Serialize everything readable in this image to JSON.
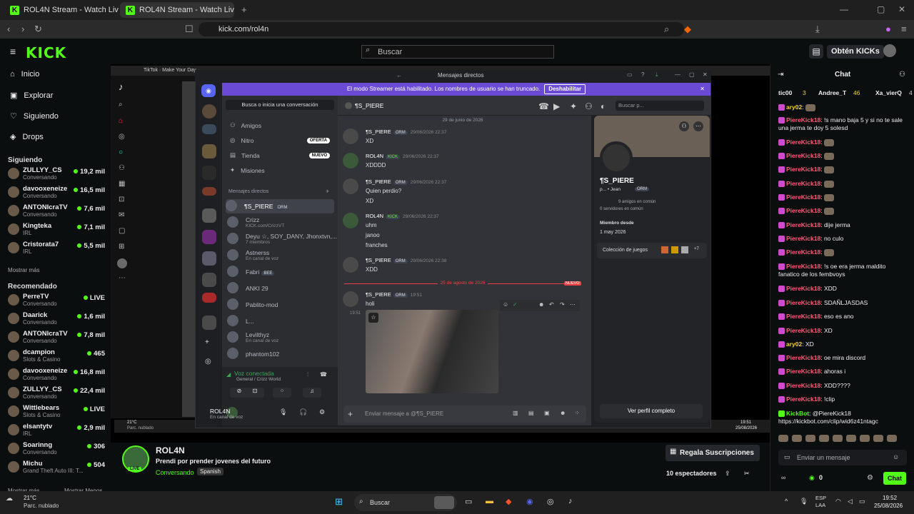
{
  "browser": {
    "tabs": [
      {
        "title": "ROL4N Stream - Watch Live on K"
      },
      {
        "title": "ROL4N Stream - Watch Live o"
      }
    ],
    "url": "kick.com/rol4n"
  },
  "kick": {
    "search_placeholder": "Buscar",
    "obten_label": "Obtén KICKs",
    "logo": "KICK",
    "nav": [
      "Inicio",
      "Explorar",
      "Siguiendo",
      "Drops"
    ],
    "following_title": "Siguiendo",
    "following": [
      {
        "name": "ZULLYY_CS",
        "sub": "Conversando",
        "viewers": "19,2 mil"
      },
      {
        "name": "davooxeneize",
        "sub": "Conversando",
        "viewers": "16,5 mil"
      },
      {
        "name": "ANTONIcraTV",
        "sub": "Conversando",
        "viewers": "7,6 mil"
      },
      {
        "name": "Kingteka",
        "sub": "IRL",
        "viewers": "7,1 mil"
      },
      {
        "name": "Cristorata7",
        "sub": "IRL",
        "viewers": "5,5 mil"
      }
    ],
    "show_more": "Mostrar más",
    "recommended_title": "Recomendado",
    "recommended": [
      {
        "name": "PerreTV",
        "sub": "Conversando",
        "viewers": "LIVE"
      },
      {
        "name": "Daarick",
        "sub": "Conversando",
        "viewers": "1,6 mil"
      },
      {
        "name": "ANTONIcraTV",
        "sub": "Conversando",
        "viewers": "7,8 mil"
      },
      {
        "name": "dcampion",
        "sub": "Slots & Casino",
        "viewers": "465"
      },
      {
        "name": "davooxeneize",
        "sub": "Conversando",
        "viewers": "16,8 mil"
      },
      {
        "name": "ZULLYY_CS",
        "sub": "Conversando",
        "viewers": "22,4 mil"
      },
      {
        "name": "Wittlebears",
        "sub": "Slots & Casino",
        "viewers": "LIVE"
      },
      {
        "name": "elsantytv",
        "sub": "IRL",
        "viewers": "2,9 mil"
      },
      {
        "name": "Soarinng",
        "sub": "Conversando",
        "viewers": "306"
      },
      {
        "name": "Michu",
        "sub": "Grand Theft Auto III: T...",
        "viewers": "504"
      }
    ],
    "show_more2": "Mostrar más",
    "show_less": "Mostrar Menos",
    "stream": {
      "channel": "ROL4N",
      "title": "Prendi por prender jovenes del futuro",
      "category": "Conversando",
      "language": "Spanish",
      "subs_button": "Regala Suscripciones",
      "viewers": "10 espectadores",
      "live": "LIVE"
    }
  },
  "tiktok": {
    "title": "TikTok · Make Your Day"
  },
  "discord": {
    "window_title": "Mensajes directos",
    "banner": "El modo Streamer está habilitado. Los nombres de usuario se han truncado.",
    "banner_btn": "Deshabilitar",
    "search_conv": "Busca o inicia una conversación",
    "nav": [
      {
        "label": "Amigos",
        "pill": ""
      },
      {
        "label": "Nitro",
        "pill": "OFERTA"
      },
      {
        "label": "Tienda",
        "pill": "NUEVO"
      },
      {
        "label": "Misiones",
        "pill": ""
      }
    ],
    "dm_title": "Mensajes directos",
    "dms": [
      {
        "name": "¶S_PIERE",
        "sub": "",
        "tag": "ORM"
      },
      {
        "name": "Crizz",
        "sub": "KICK.com/CrizzVT",
        "tag": ""
      },
      {
        "name": "Deyu ☆, SOY_DANY, Jhonxtvn,...",
        "sub": "7 miembros",
        "tag": ""
      },
      {
        "name": "Astnerss",
        "sub": "En canal de voz",
        "tag": ""
      },
      {
        "name": "Fabri",
        "sub": "",
        "tag": "BEE"
      },
      {
        "name": "ANKI 29",
        "sub": "",
        "tag": ""
      },
      {
        "name": "Pablito-mod",
        "sub": "",
        "tag": ""
      },
      {
        "name": "L...",
        "sub": "",
        "tag": ""
      },
      {
        "name": "Levilthyz",
        "sub": "En canal de voz",
        "tag": ""
      },
      {
        "name": "phantom102",
        "sub": "",
        "tag": ""
      }
    ],
    "voice": {
      "status": "Voz conectada",
      "channel": "General / Crizz World"
    },
    "me": {
      "name": "ROL4N",
      "status": "En canal de voz"
    },
    "chat_user": "¶S_PIERE",
    "search_placeholder": "Buscar p...",
    "date1": "29 de junio de 2026",
    "date2": "25 de agosto de 2026",
    "new_label": "NUEVO",
    "messages": [
      {
        "user": "¶S_PIERE",
        "tag": "ORM",
        "ts": "29/06/2026 22:37",
        "lines": [
          "XD"
        ]
      },
      {
        "user": "ROL4N",
        "tag": "KICK",
        "ts": "29/06/2026 22:37",
        "lines": [
          "XDDDD"
        ]
      },
      {
        "user": "¶S_PIERE",
        "tag": "ORM",
        "ts": "29/06/2026 22:37",
        "lines": [
          "Quien perdio?",
          "XD"
        ]
      },
      {
        "user": "ROL4N",
        "tag": "KICK",
        "ts": "29/06/2026 22:37",
        "lines": [
          "uhm",
          "janoo",
          "franches"
        ]
      },
      {
        "user": "¶S_PIERE",
        "tag": "ORM",
        "ts": "29/06/2026 22:38",
        "lines": [
          "XDD"
        ]
      },
      {
        "user": "¶S_PIERE",
        "tag": "ORM",
        "ts": "19:51",
        "lines": [
          "holi"
        ]
      }
    ],
    "side_ts": "19:51",
    "input_placeholder": "Enviar mensaje a @¶S_PIERE",
    "profile": {
      "name": "¶S_PIERE",
      "sub": "p... • Jean",
      "tag": "ORM",
      "mutual_friends": "9 amigos en común",
      "mutual_servers": "0 servidores en común",
      "member_since_label": "Miembro desde",
      "member_since": "1 may 2026",
      "games_label": "Colección de juegos",
      "games_more": "+7",
      "view_full": "Ver perfil completo"
    }
  },
  "chat": {
    "title": "Chat",
    "top_gifters": [
      {
        "name": "tic00",
        "count": "3"
      },
      {
        "name": "Andree_T",
        "count": "46"
      },
      {
        "name": "Xa_vierQ",
        "count": "4"
      }
    ],
    "messages": [
      {
        "user": "ary02",
        "text": "",
        "style": "u2"
      },
      {
        "user": "PiereKick18",
        "text": "!s mano baja 5 y si no te sale una jerma te doy 5 solesd",
        "style": "u"
      },
      {
        "user": "PiereKick18",
        "text": "",
        "style": "u"
      },
      {
        "user": "PiereKick18",
        "text": "",
        "style": "u"
      },
      {
        "user": "PiereKick18",
        "text": "",
        "style": "u"
      },
      {
        "user": "PiereKick18",
        "text": "",
        "style": "u"
      },
      {
        "user": "PiereKick18",
        "text": "",
        "style": "u"
      },
      {
        "user": "PiereKick18",
        "text": "",
        "style": "u"
      },
      {
        "user": "PiereKick18",
        "text": "dije jerma",
        "style": "u"
      },
      {
        "user": "PiereKick18",
        "text": "no culo",
        "style": "u"
      },
      {
        "user": "PiereKick18",
        "text": "",
        "style": "u"
      },
      {
        "user": "PiereKick18",
        "text": "!s oe era jerma maldito fanatico de los fembvoys",
        "style": "u"
      },
      {
        "user": "PiereKick18",
        "text": "XDD",
        "style": "u"
      },
      {
        "user": "PiereKick18",
        "text": "SDAÑLJASDAS",
        "style": "u"
      },
      {
        "user": "PiereKick18",
        "text": "eso es ano",
        "style": "u"
      },
      {
        "user": "PiereKick18",
        "text": "XD",
        "style": "u"
      },
      {
        "user": "ary02",
        "text": "XD",
        "style": "u2"
      },
      {
        "user": "PiereKick18",
        "text": "oe mira discord",
        "style": "u"
      },
      {
        "user": "PiereKick18",
        "text": "ahoras i",
        "style": "u"
      },
      {
        "user": "PiereKick18",
        "text": "XDD????",
        "style": "u"
      },
      {
        "user": "PiereKick18",
        "text": "!clip",
        "style": "u"
      },
      {
        "user": "KickBot",
        "text": "@PiereKick18 https://kickbot.com/clip/wid6z41ntagc",
        "style": "u3"
      }
    ],
    "input_placeholder": "Enviar un mensaje",
    "kicks": "0",
    "send": "Chat"
  },
  "taskbar": {
    "weather_temp": "21°C",
    "weather_desc": "Parc. nublado",
    "search": "Buscar",
    "lang": "ESP",
    "lang2": "LAA",
    "time": "19:52",
    "date": "25/08/2026"
  },
  "inner_taskbar": {
    "weather_temp": "21°C",
    "weather_desc": "Parc. nublado",
    "time": "19:51",
    "date": "25/08/2026"
  }
}
